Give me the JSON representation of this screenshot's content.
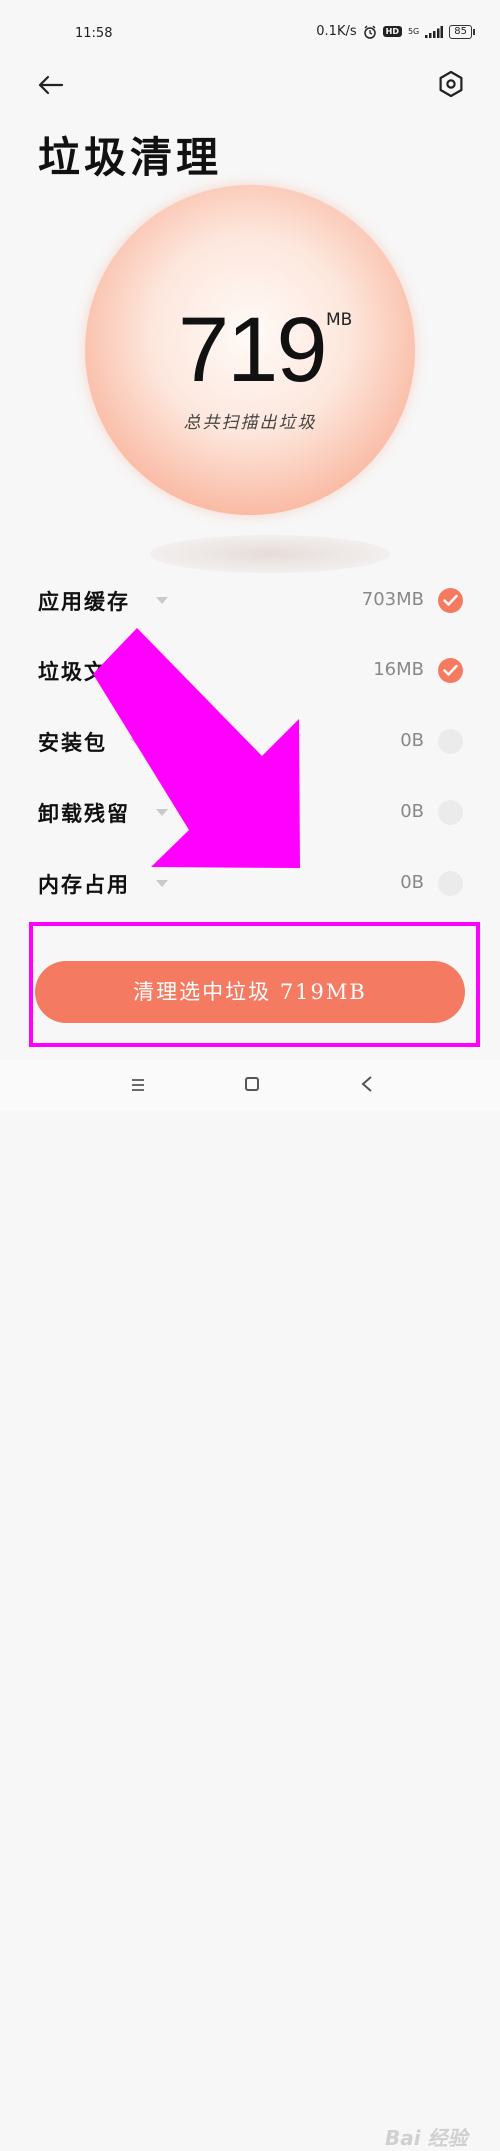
{
  "status_bar": {
    "time": "11:58",
    "network_speed": "0.1K/s",
    "hd_label": "HD",
    "network_type": "5G",
    "battery": "85",
    "icons": [
      "alarm-icon",
      "signal-icon",
      "battery-icon"
    ]
  },
  "header": {
    "back_icon": "back-arrow-icon",
    "settings_icon": "settings-hexagon-icon",
    "title": "垃圾清理"
  },
  "summary": {
    "total_value": "719",
    "total_unit": "MB",
    "caption": "总共扫描出垃圾"
  },
  "items": [
    {
      "label": "应用缓存",
      "size": "703MB",
      "checked": true
    },
    {
      "label": "垃圾文件",
      "size": "16MB",
      "checked": true
    },
    {
      "label": "安装包",
      "size": "0B",
      "checked": false
    },
    {
      "label": "卸载残留",
      "size": "0B",
      "checked": false
    },
    {
      "label": "内存占用",
      "size": "0B",
      "checked": false
    }
  ],
  "action": {
    "clean_label": "清理选中垃圾 719MB"
  },
  "watermark": "Bai 经验",
  "colors": {
    "accent": "#f47a62",
    "annotation": "#ff00ff",
    "background": "#f7f7f7"
  }
}
